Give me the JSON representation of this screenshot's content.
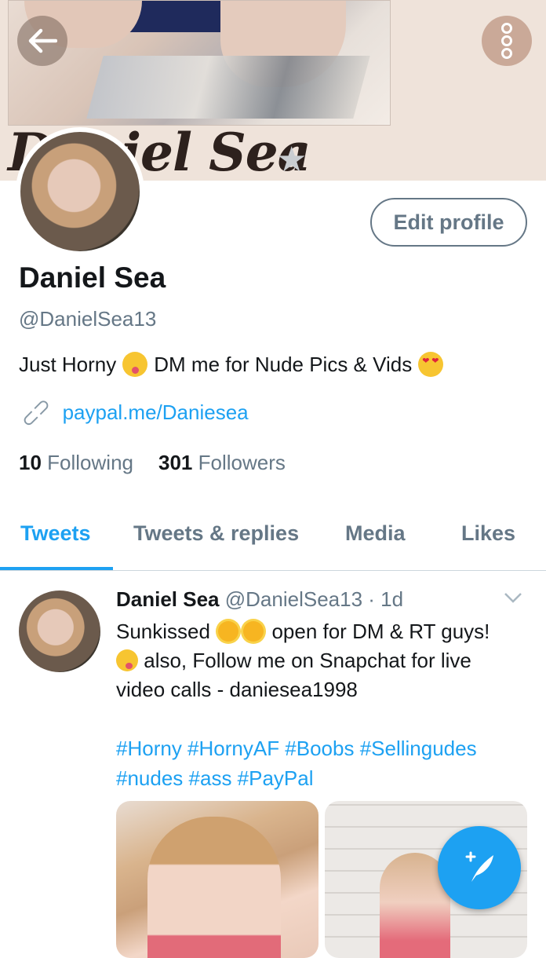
{
  "header": {
    "banner_script_text": "Daniel Sea",
    "back_icon": "arrow-left-icon",
    "more_icon": "more-vertical-icon"
  },
  "profile": {
    "edit_profile_label": "Edit profile",
    "name": "Daniel Sea",
    "handle": "@DanielSea13",
    "bio_part1": "Just Horny",
    "bio_part2": "DM me for Nude Pics & Vids",
    "link": "paypal.me/Daniesea",
    "following_count": "10",
    "following_label": "Following",
    "followers_count": "301",
    "followers_label": "Followers"
  },
  "tabs": [
    "Tweets",
    "Tweets & replies",
    "Media",
    "Likes"
  ],
  "active_tab": "Tweets",
  "tweet": {
    "name": "Daniel Sea",
    "handle": "@DanielSea13",
    "time": "· 1d",
    "line1_a": "Sunkissed",
    "line1_b": "open for DM & RT guys!",
    "line2": "also, Follow me on Snapchat for live",
    "line3": "video calls - daniesea1998",
    "hashtags_line1": "#Horny #HornyAF #Boobs #Sellingudes",
    "hashtags_line2": "#nudes #ass #PayPal"
  },
  "colors": {
    "accent": "#1da1f2",
    "secondary_text": "#657786",
    "primary_text": "#14171a"
  },
  "fab_icon": "compose-tweet-icon"
}
